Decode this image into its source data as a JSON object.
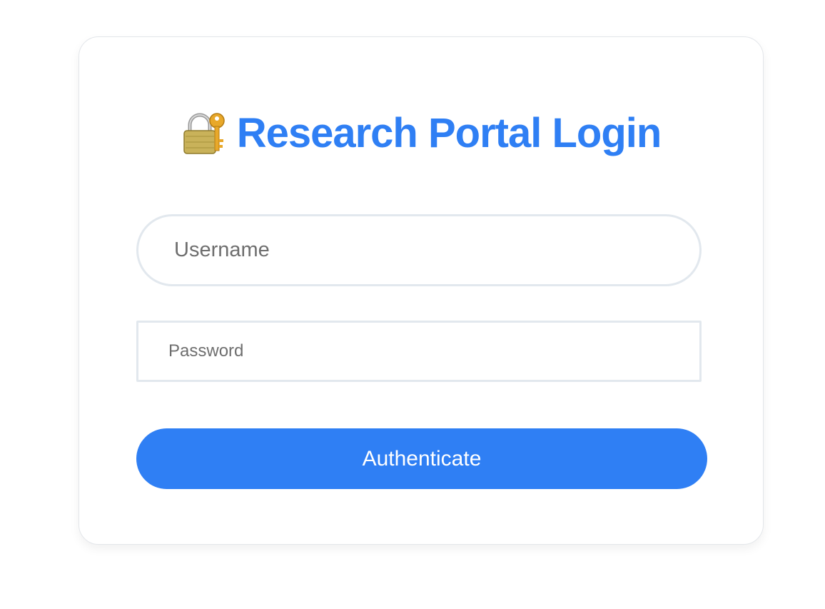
{
  "login": {
    "title": "Research Portal Login",
    "title_icon": "lock-with-key-icon",
    "username_placeholder": "Username",
    "password_placeholder": "Password",
    "submit_label": "Authenticate"
  },
  "colors": {
    "accent": "#2f7ff4",
    "input_border": "#e2e8ee",
    "card_border": "#e3e6ea",
    "placeholder_text": "#6e6e6e"
  }
}
